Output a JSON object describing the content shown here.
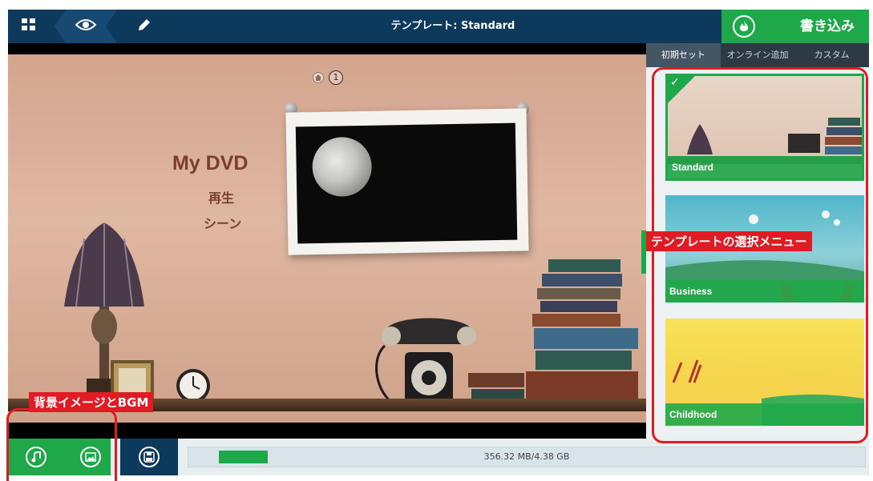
{
  "topbar": {
    "title": "テンプレート: Standard",
    "burn_label": "書き込み",
    "nav_icons": [
      "grid-icon",
      "eye-icon",
      "pencil-icon"
    ]
  },
  "preview": {
    "menu_title": "My DVD",
    "menu_items": [
      "再生",
      "シーン"
    ],
    "page_number": "1"
  },
  "side_panel": {
    "tabs": [
      {
        "label": "初期セット",
        "active": true
      },
      {
        "label": "オンライン追加",
        "active": false
      },
      {
        "label": "カスタム",
        "active": false
      }
    ],
    "templates": [
      {
        "name": "Standard",
        "selected": true
      },
      {
        "name": "Business",
        "selected": false
      },
      {
        "name": "Childhood",
        "selected": false
      }
    ]
  },
  "bottombar": {
    "icons": [
      "music-icon",
      "image-icon",
      "save-icon"
    ],
    "usage_text": "356.32 MB/4.38 GB",
    "usage_fraction": 0.079
  },
  "annotations": {
    "template_menu": "テンプレートの選択メニュー",
    "bg_and_bgm": "背景イメージとBGM"
  },
  "colors": {
    "accent_green": "#1fa84a",
    "navy": "#0d3a5c",
    "annotation_red": "#e01b24"
  }
}
